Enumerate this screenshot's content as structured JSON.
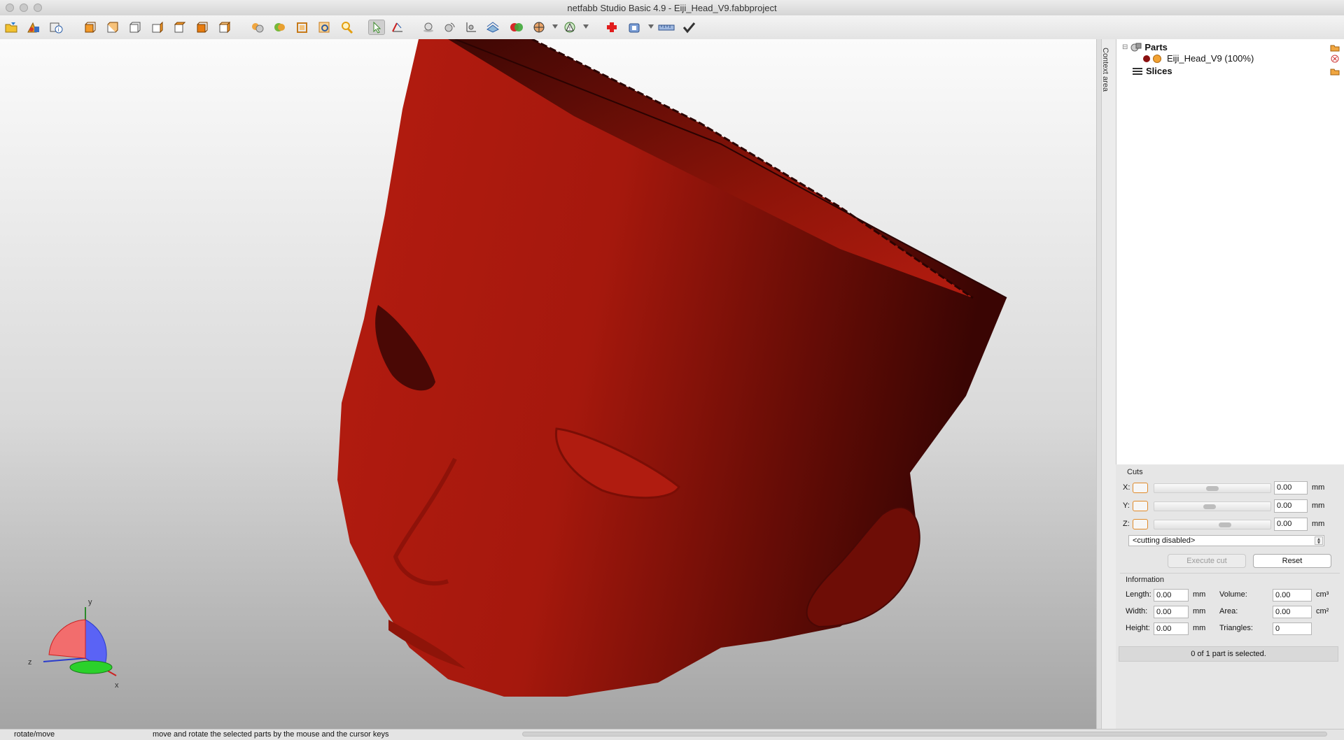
{
  "window": {
    "title": "netfabb Studio Basic 4.9 - Eiji_Head_V9.fabbproject"
  },
  "toolbar": {
    "icons": [
      "open-project-icon",
      "add-part-icon",
      "part-info-icon",
      "view-front-icon",
      "view-back-icon",
      "view-left-icon",
      "view-right-icon",
      "view-top-icon",
      "view-bottom-icon",
      "view-iso-icon",
      "show-spheres-icon",
      "shaded-view-icon",
      "wireframe-view-icon",
      "zoom-selection-icon",
      "zoom-icon",
      "select-tool-icon",
      "measure-icon",
      "move-to-origin-icon",
      "rotate-part-icon",
      "axes-icon",
      "slice-view-icon",
      "part-color-icon",
      "section-view-icon",
      "warning-check-icon",
      "repair-icon",
      "export-icon",
      "ruler-icon",
      "checkmark-icon"
    ]
  },
  "viewport": {
    "part_color": "#b81d12",
    "axes": {
      "x": "x",
      "y": "y",
      "z": "z"
    }
  },
  "context_area": {
    "label": "Context area"
  },
  "tree": {
    "parts_label": "Parts",
    "part_item": "Eiji_Head_V9 (100%)",
    "slices_label": "Slices"
  },
  "cuts": {
    "title": "Cuts",
    "rows": [
      {
        "axis": "X:",
        "value": "0.00",
        "unit": "mm",
        "slider": 0.5
      },
      {
        "axis": "Y:",
        "value": "0.00",
        "unit": "mm",
        "slider": 0.47
      },
      {
        "axis": "Z:",
        "value": "0.00",
        "unit": "mm",
        "slider": 0.62
      }
    ],
    "mode": "<cutting disabled>",
    "execute_label": "Execute cut",
    "reset_label": "Reset"
  },
  "information": {
    "title": "Information",
    "length_label": "Length:",
    "length_value": "0.00",
    "length_unit": "mm",
    "width_label": "Width:",
    "width_value": "0.00",
    "width_unit": "mm",
    "height_label": "Height:",
    "height_value": "0.00",
    "height_unit": "mm",
    "volume_label": "Volume:",
    "volume_value": "0.00",
    "volume_unit": "cm³",
    "area_label": "Area:",
    "area_value": "0.00",
    "area_unit": "cm²",
    "triangles_label": "Triangles:",
    "triangles_value": "0"
  },
  "selection_status": "0 of 1 part is selected.",
  "statusbar": {
    "mode": "rotate/move",
    "hint": "move and rotate the selected parts by the mouse and the cursor keys"
  }
}
